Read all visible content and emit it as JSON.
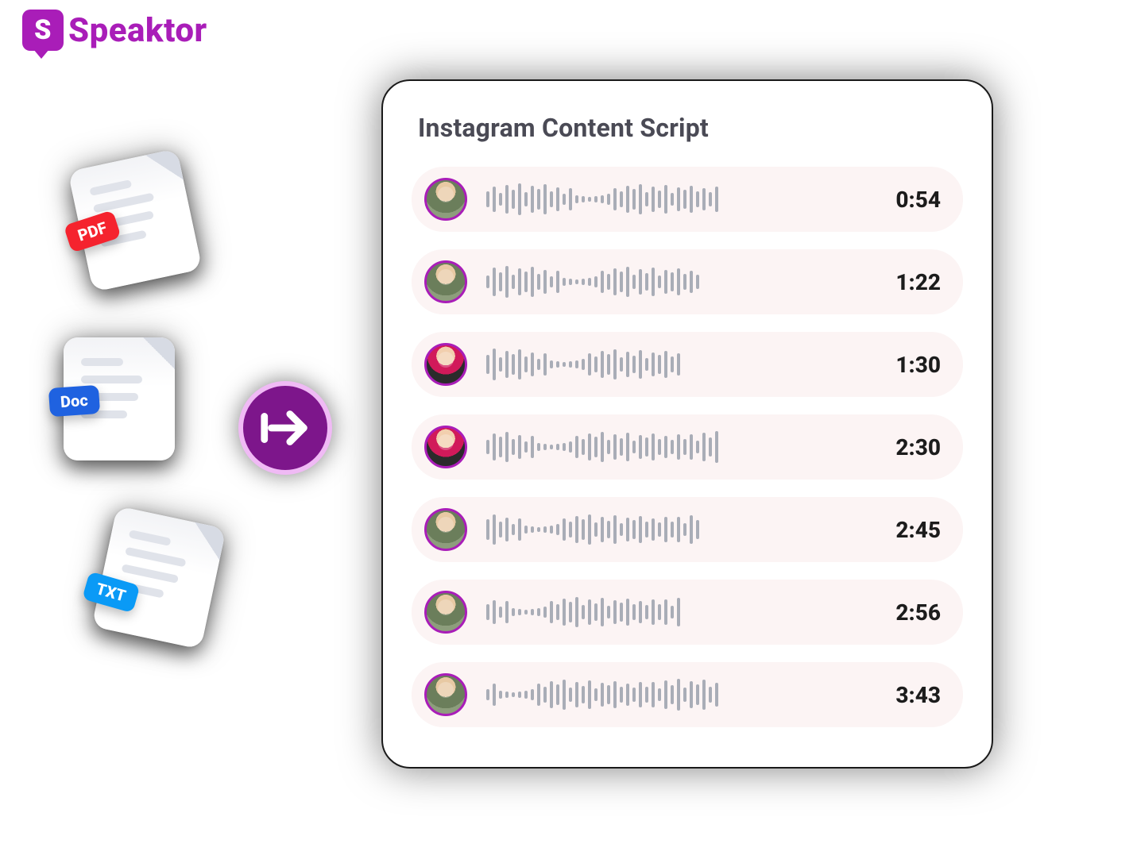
{
  "brand": {
    "name": "Speaktor",
    "mark_letter": "S"
  },
  "files": [
    {
      "type": "PDF",
      "badge_class": "pdf"
    },
    {
      "type": "Doc",
      "badge_class": "doc"
    },
    {
      "type": "TXT",
      "badge_class": "txt"
    }
  ],
  "card": {
    "title": "Instagram Content Script",
    "tracks": [
      {
        "avatar_style": "a",
        "duration": "0:54"
      },
      {
        "avatar_style": "a",
        "duration": "1:22"
      },
      {
        "avatar_style": "b",
        "duration": "1:30"
      },
      {
        "avatar_style": "b",
        "duration": "2:30"
      },
      {
        "avatar_style": "a",
        "duration": "2:45"
      },
      {
        "avatar_style": "a",
        "duration": "2:56"
      },
      {
        "avatar_style": "a",
        "duration": "3:43"
      }
    ]
  },
  "waveform_heights": [
    20,
    32,
    16,
    36,
    24,
    40,
    18,
    34,
    26,
    38,
    20,
    30,
    14,
    28,
    10,
    8,
    6,
    8,
    10,
    14,
    28,
    20,
    34,
    26,
    38,
    18,
    32,
    22,
    36,
    16,
    30,
    24,
    34,
    20,
    28,
    18,
    32
  ]
}
